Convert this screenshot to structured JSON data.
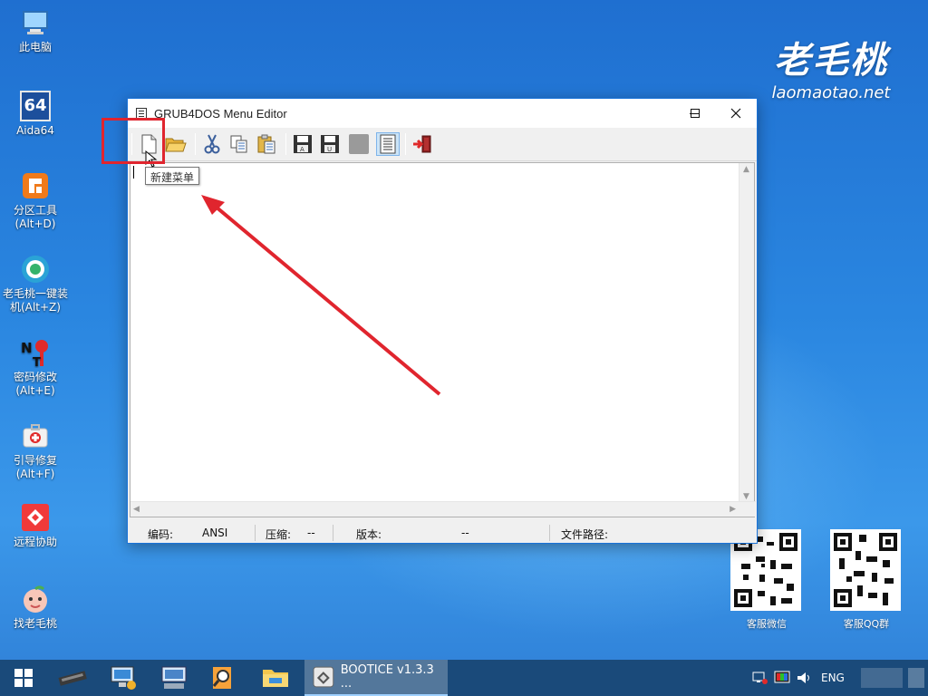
{
  "desktop": {
    "icons": [
      {
        "label": "此电脑"
      },
      {
        "label": "Aida64",
        "badge": "64"
      },
      {
        "label": "分区工具\n(Alt+D)"
      },
      {
        "label": "老毛桃一键装\n机(Alt+Z)"
      },
      {
        "label": "密码修改\n(Alt+E)",
        "badge": "NT"
      },
      {
        "label": "引导修复\n(Alt+F)"
      },
      {
        "label": "远程协助"
      },
      {
        "label": "找老毛桃"
      }
    ]
  },
  "brand": {
    "name": "老毛桃",
    "url": "laomaotao.net"
  },
  "qr": [
    {
      "label": "客服微信"
    },
    {
      "label": "客服QQ群"
    }
  ],
  "window": {
    "title": "GRUB4DOS Menu Editor",
    "controls": {
      "minimize": "—",
      "maximize": "☐",
      "close": "✕"
    },
    "toolbar": {
      "buttons": [
        "new-menu",
        "open",
        "cut",
        "copy",
        "paste",
        "save-ansi",
        "save-unicode",
        "disabled",
        "view-text",
        "exit"
      ]
    },
    "tooltip": "新建菜单",
    "status": {
      "encoding_label": "编码:",
      "encoding_value": "ANSI",
      "compress_label": "压缩:",
      "compress_value": "--",
      "version_label": "版本:",
      "version_value": "--",
      "path_label": "文件路径:"
    }
  },
  "taskbar": {
    "active_task": "BOOTICE v1.3.3 ...",
    "language": "ENG"
  },
  "colors": {
    "highlight": "#e0252e",
    "arrow": "#e0252e",
    "titlebar_border": "#1a73d9"
  }
}
